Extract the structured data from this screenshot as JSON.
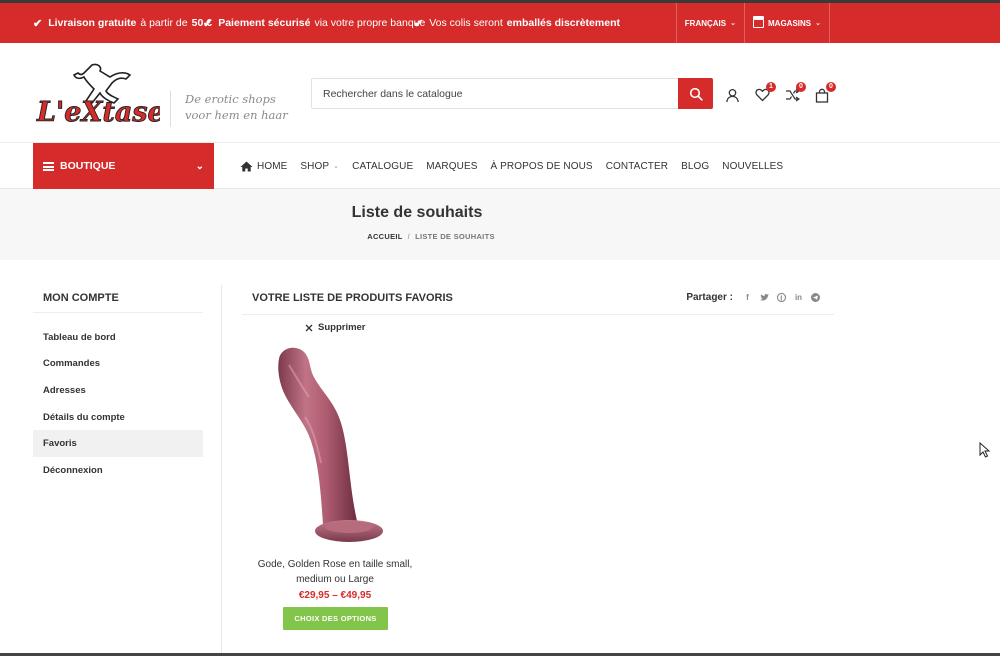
{
  "topbar": {
    "promos": [
      {
        "bold": "Livraison gratuite",
        "rest": " à partir de ",
        "bold2": "50 €"
      },
      {
        "bold": "Paiement sécurisé",
        "rest": " via votre propre banque",
        "bold2": ""
      },
      {
        "bold": "",
        "rest": "Vos colis seront ",
        "bold2": "emballés discrètement"
      }
    ],
    "language": "FRANÇAIS",
    "stores": "MAGASINS"
  },
  "header": {
    "logo_text": "L'eXtase",
    "tagline_line1": "De erotic shops",
    "tagline_line2": "voor hem en haar",
    "search_placeholder": "Rechercher dans le catalogue",
    "wishlist_count": "1",
    "compare_count": "0",
    "cart_count": "0"
  },
  "nav": {
    "boutique": "BOUTIQUE",
    "items": [
      "HOME",
      "SHOP",
      "CATALOGUE",
      "MARQUES",
      "À PROPOS DE NOUS",
      "CONTACTER",
      "BLOG",
      "NOUVELLES"
    ]
  },
  "page": {
    "title": "Liste de souhaits",
    "breadcrumb_home": "ACCUEIL",
    "breadcrumb_sep": "/",
    "breadcrumb_current": "LISTE DE SOUHAITS"
  },
  "sidebar": {
    "title": "MON COMPTE",
    "items": [
      "Tableau de bord",
      "Commandes",
      "Adresses",
      "Détails du compte",
      "Favoris",
      "Déconnexion"
    ],
    "active": "Favoris"
  },
  "wishlist": {
    "title": "VOTRE LISTE DE PRODUITS FAVORIS",
    "share_label": "Partager :",
    "remove_label": "Supprimer",
    "product": {
      "name_line1": "Gode, Golden Rose en taille small,",
      "name_line2": "medium ou Large",
      "price": "€29,95 – €49,95",
      "button": "CHOIX DES OPTIONS"
    }
  },
  "colors": {
    "accent": "#d62b2b",
    "button_green": "#83c44a"
  }
}
